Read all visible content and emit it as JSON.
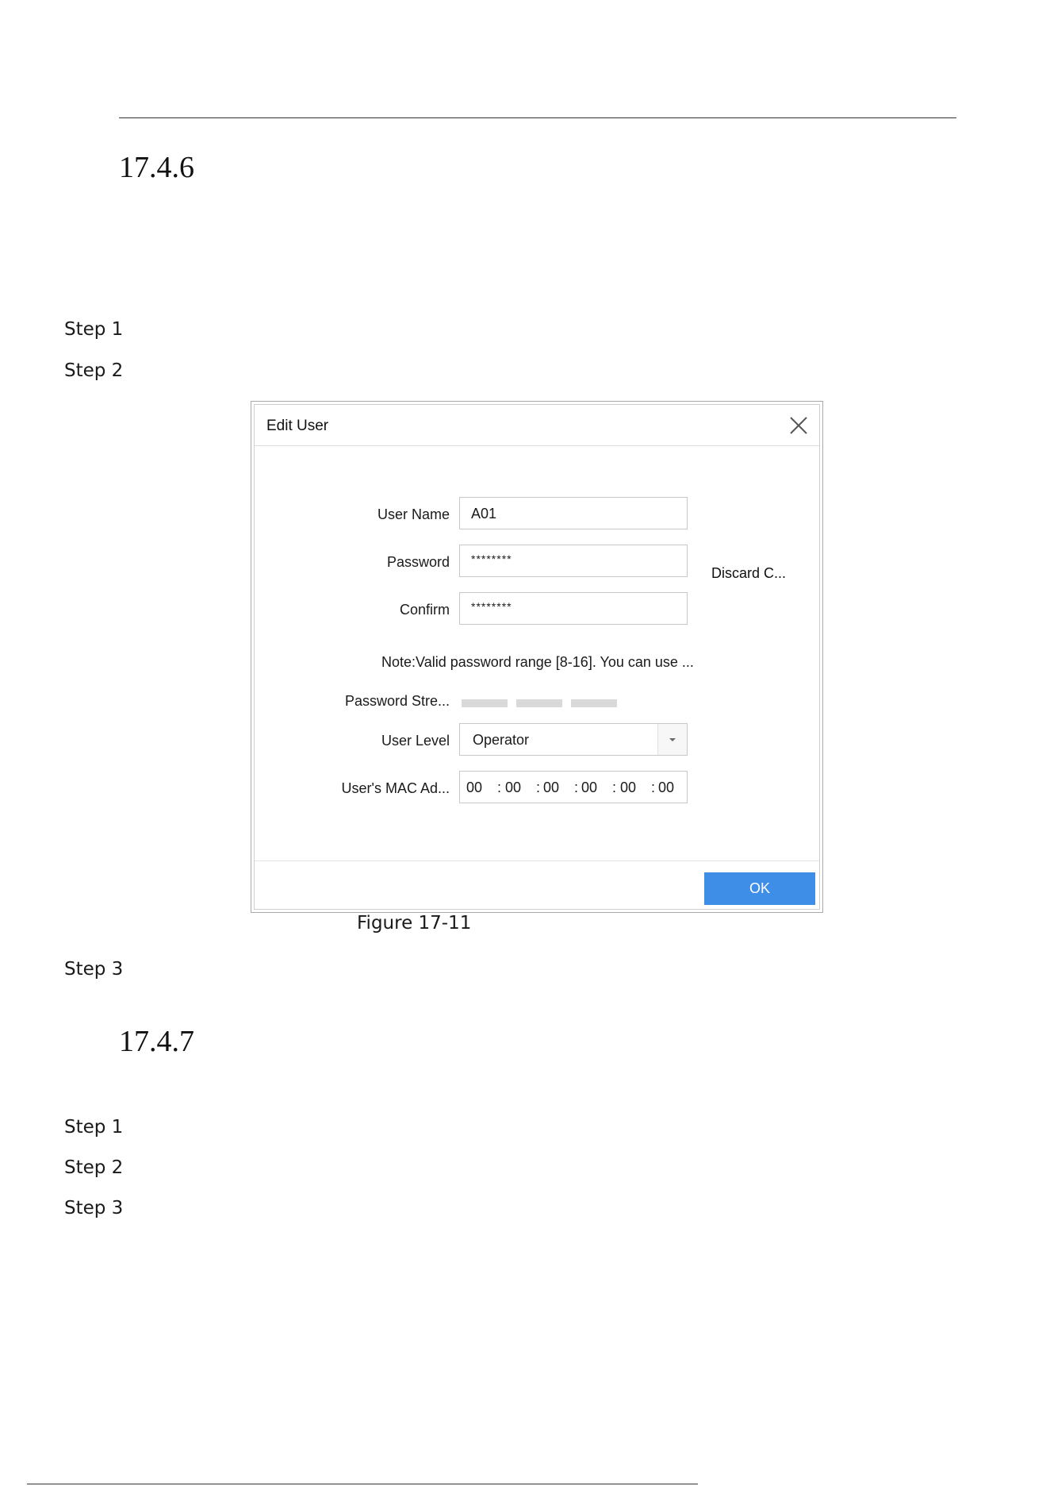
{
  "sections": [
    {
      "number": "17.4.6"
    },
    {
      "number": "17.4.7"
    }
  ],
  "steps_before_figure": [
    "Step 1",
    "Step 2"
  ],
  "step_after_figure": "Step 3",
  "steps_section2": [
    "Step 1",
    "Step 2",
    "Step 3"
  ],
  "figure_caption": "Figure 17-11",
  "dialog": {
    "title": "Edit User",
    "close_icon": "close-icon",
    "user_name_label": "User Name",
    "user_name_value": "A01",
    "password_label": "Password",
    "password_value": "********",
    "discard_label": "Discard C...",
    "confirm_label": "Confirm",
    "confirm_value": "********",
    "note": "Note:Valid password range [8-16]. You can use ...",
    "strength_label": "Password Stre...",
    "user_level_label": "User Level",
    "user_level_value": "Operator",
    "mac_label": "User's MAC Ad...",
    "mac_segments": [
      "00",
      "00",
      "00",
      "00",
      "00",
      "00"
    ],
    "mac_separator": ":",
    "ok_label": "OK"
  },
  "colors": {
    "ok_button": "#3e8ee8",
    "strength_bar_inactive": "#d9d9d9"
  }
}
